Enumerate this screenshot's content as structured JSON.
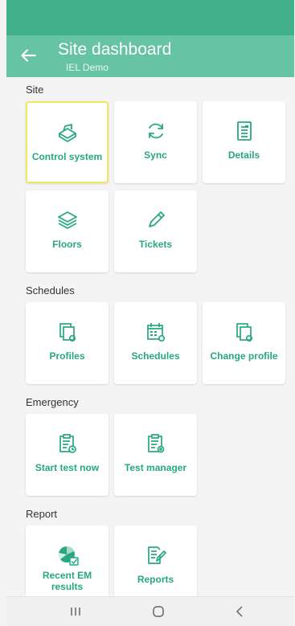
{
  "header": {
    "title": "Site dashboard",
    "subtitle": "IEL Demo"
  },
  "sections": [
    {
      "label": "Site"
    },
    {
      "label": "Schedules"
    },
    {
      "label": "Emergency"
    },
    {
      "label": "Report"
    }
  ],
  "tiles": [
    {
      "label": "Control system",
      "icon": "control-system-icon",
      "selected": true
    },
    {
      "label": "Sync",
      "icon": "sync-icon"
    },
    {
      "label": "Details",
      "icon": "details-icon"
    },
    {
      "label": "Floors",
      "icon": "floors-icon"
    },
    {
      "label": "Tickets",
      "icon": "tickets-icon"
    },
    {
      "label": "Profiles",
      "icon": "profiles-icon"
    },
    {
      "label": "Schedules",
      "icon": "schedules-icon"
    },
    {
      "label": "Change profile",
      "icon": "change-profile-icon"
    },
    {
      "label": "Start test now",
      "icon": "start-test-icon"
    },
    {
      "label": "Test manager",
      "icon": "test-manager-icon"
    },
    {
      "label": "Recent EM results",
      "icon": "recent-results-icon"
    },
    {
      "label": "Reports",
      "icon": "reports-icon"
    }
  ],
  "colors": {
    "statusbar": "#43b08c",
    "appbar": "#66c3a4",
    "accent": "#27a882",
    "selected_outline": "#f1e95a"
  }
}
